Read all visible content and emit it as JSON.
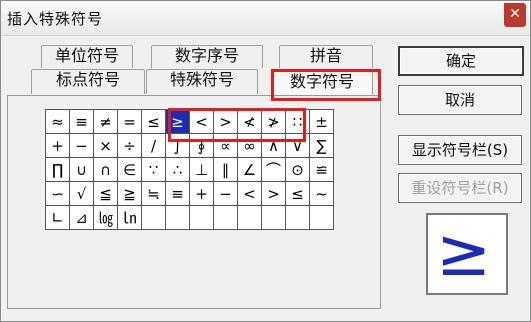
{
  "window": {
    "title": "插入特殊符号",
    "close_icon": "close-icon"
  },
  "tabs": {
    "row1": [
      "单位符号",
      "数字序号",
      "拼音"
    ],
    "row2": [
      "标点符号",
      "特殊符号",
      "数字符号"
    ],
    "active": "数字符号"
  },
  "symbols": [
    [
      "≈",
      "≡",
      "≠",
      "=",
      "≤",
      "≥",
      "<",
      ">",
      "≮",
      "≯",
      "∷",
      "±"
    ],
    [
      "+",
      "−",
      "×",
      "÷",
      "/",
      "∫",
      "∮",
      "∝",
      "∞",
      "∧",
      "∨",
      "∑"
    ],
    [
      "∏",
      "∪",
      "∩",
      "∈",
      "∵",
      "∴",
      "⊥",
      "∥",
      "∠",
      "⌒",
      "⊙",
      "≌"
    ],
    [
      "∽",
      "√",
      "≦",
      "≧",
      "≒",
      "≡",
      "+",
      "−",
      "<",
      ">",
      "≤",
      "~"
    ],
    [
      "∟",
      "⊿",
      "㏒",
      "㏑"
    ]
  ],
  "selected_symbol": "≥",
  "buttons": {
    "ok": "确定",
    "cancel": "取消",
    "show_toolbar": "显示符号栏(S)",
    "reset_toolbar": "重设符号栏(R)"
  },
  "preview_symbol": "≥",
  "colors": {
    "selection": "#1c2cb8",
    "highlight": "#e21d1d"
  }
}
